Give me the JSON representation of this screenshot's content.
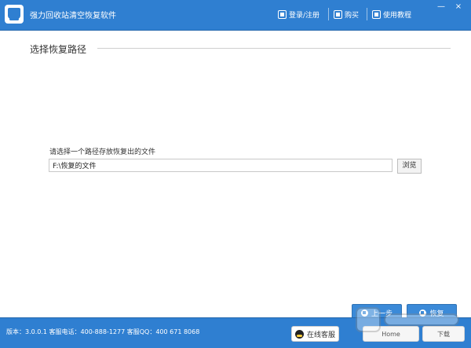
{
  "window": {
    "title": "强力回收站清空恢复软件",
    "menu": {
      "login": "登录/注册",
      "buy": "购买",
      "tutorial": "使用教程"
    },
    "controls": {
      "minimize": "—",
      "close": "×"
    }
  },
  "main": {
    "section_title": "选择恢复路径",
    "path_label": "请选择一个路径存放恢复出的文件",
    "path_value": "F:\\恢复的文件",
    "browse_label": "浏览",
    "prev_label": "上一步",
    "recover_label": "恢复"
  },
  "footer": {
    "info": "版本：3.0.0.1  客服电话：400-888-1277    客服QQ：400 671 8068",
    "support_label": "在线客服",
    "other1": "Home",
    "other2": "下载"
  },
  "colors": {
    "primary": "#2f7fd1",
    "button_blue": "#3b8ad8"
  },
  "icons": {
    "app": "recycle-bin-icon",
    "login": "user-icon",
    "buy": "cart-icon",
    "tutorial": "book-icon",
    "support": "qq-icon"
  }
}
